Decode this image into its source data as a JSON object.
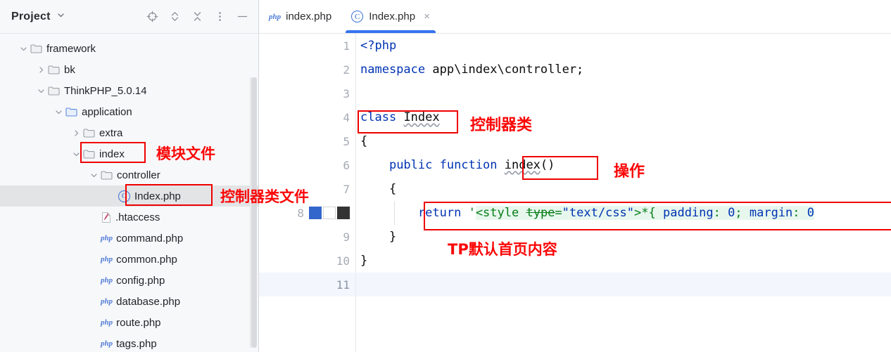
{
  "sidebar": {
    "title": "Project",
    "header_icons": [
      {
        "name": "locate-target-icon",
        "glyph": "⊕"
      },
      {
        "name": "expand-collapse-icon",
        "glyph": "⌃"
      },
      {
        "name": "collapse-all-icon",
        "glyph": "✕"
      },
      {
        "name": "more-options-icon",
        "glyph": "⋮"
      },
      {
        "name": "minimize-icon",
        "glyph": "—"
      }
    ],
    "tree": [
      {
        "label": "framework",
        "icon": "folder",
        "arrow": "down",
        "indent": 0,
        "selected": false
      },
      {
        "label": "bk",
        "icon": "folder",
        "arrow": "right",
        "indent": 1,
        "selected": false
      },
      {
        "label": "ThinkPHP_5.0.14",
        "icon": "folder",
        "arrow": "down",
        "indent": 1,
        "selected": false
      },
      {
        "label": "application",
        "icon": "folder-blue",
        "arrow": "down",
        "indent": 2,
        "selected": false
      },
      {
        "label": "extra",
        "icon": "folder",
        "arrow": "right",
        "indent": 3,
        "selected": false
      },
      {
        "label": "index",
        "icon": "folder",
        "arrow": "down",
        "indent": 3,
        "selected": false
      },
      {
        "label": "controller",
        "icon": "folder",
        "arrow": "down",
        "indent": 4,
        "selected": false
      },
      {
        "label": "Index.php",
        "icon": "class-c",
        "arrow": "none",
        "indent": 5,
        "selected": true
      },
      {
        "label": ".htaccess",
        "icon": "htaccess",
        "arrow": "none",
        "indent": 4,
        "selected": false
      },
      {
        "label": "command.php",
        "icon": "php",
        "arrow": "none",
        "indent": 4,
        "selected": false
      },
      {
        "label": "common.php",
        "icon": "php",
        "arrow": "none",
        "indent": 4,
        "selected": false
      },
      {
        "label": "config.php",
        "icon": "php",
        "arrow": "none",
        "indent": 4,
        "selected": false
      },
      {
        "label": "database.php",
        "icon": "php",
        "arrow": "none",
        "indent": 4,
        "selected": false
      },
      {
        "label": "route.php",
        "icon": "php",
        "arrow": "none",
        "indent": 4,
        "selected": false
      },
      {
        "label": "tags.php",
        "icon": "php",
        "arrow": "none",
        "indent": 4,
        "selected": false
      }
    ]
  },
  "editor": {
    "tabs": [
      {
        "label": "index.php",
        "icon": "php",
        "active": false,
        "closable": false
      },
      {
        "label": "Index.php",
        "icon": "class-c",
        "active": true,
        "closable": true
      }
    ],
    "close_glyph": "×",
    "gutter": {
      "lines": [
        "1",
        "2",
        "3",
        "4",
        "5",
        "6",
        "7",
        "8",
        "9",
        "10",
        "11"
      ],
      "current_line": "11",
      "swatch_line": "8",
      "swatches": [
        "#3366cc",
        "#ffffff",
        "#333333"
      ]
    },
    "lines": [
      {
        "n": "1",
        "text": "<?php"
      },
      {
        "n": "2",
        "text": "namespace app\\index\\controller;"
      },
      {
        "n": "3",
        "text": ""
      },
      {
        "n": "4",
        "text": "class Index"
      },
      {
        "n": "5",
        "text": "{"
      },
      {
        "n": "6",
        "text": "    public function index()"
      },
      {
        "n": "7",
        "text": "    {"
      },
      {
        "n": "8",
        "text": "        return '<style type=\"text/css\">*{ padding: 0; margin: 0"
      },
      {
        "n": "9",
        "text": "    }"
      },
      {
        "n": "10",
        "text": "}"
      },
      {
        "n": "11",
        "text": ""
      }
    ]
  },
  "annotations": {
    "module_files": "模块文件",
    "controller_class_file": "控制器类文件",
    "controller_class": "控制器类",
    "operation": "操作",
    "tp_default_home_content": "TP默认首页内容",
    "color": "#fb0707"
  }
}
